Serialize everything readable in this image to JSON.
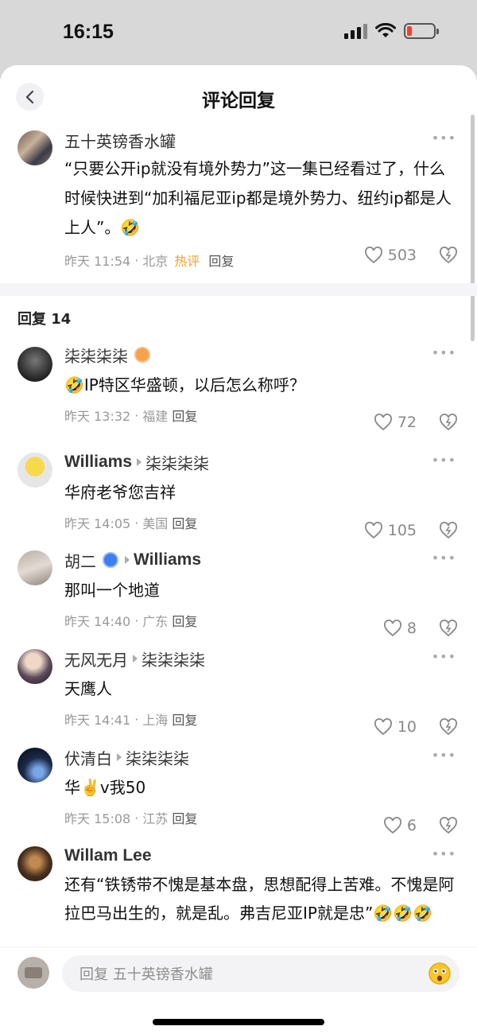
{
  "status": {
    "time": "16:15"
  },
  "header": {
    "title": "评论回复"
  },
  "main_comment": {
    "author": "五十英镑香水罐",
    "text": "“只要公开ip就没有境外势力”这一集已经看过了，什么时候快进到“加利福尼亚ip都是境外势力、纽约ip都是人上人”。🤣",
    "time": "昨天 11:54",
    "location": "北京",
    "hot_label": "热评",
    "reply_label": "回复",
    "likes": "503"
  },
  "replies_header": "回复 14",
  "replies": [
    {
      "author": "柒柒柒柒",
      "target": "",
      "text": "🤣IP特区华盛顿，以后怎么称呼？",
      "time": "昨天 13:32",
      "location": "福建",
      "reply_label": "回复",
      "likes": "72"
    },
    {
      "author": "Williams",
      "target": "柒柒柒柒",
      "text": "华府老爷您吉祥",
      "time": "昨天 14:05",
      "location": "美国",
      "reply_label": "回复",
      "likes": "105"
    },
    {
      "author": "胡二",
      "target": "Williams",
      "text": "那叫一个地道",
      "time": "昨天 14:40",
      "location": "广东",
      "reply_label": "回复",
      "likes": "8"
    },
    {
      "author": "无风无月",
      "target": "柒柒柒柒",
      "text": "天鹰人",
      "time": "昨天 14:41",
      "location": "上海",
      "reply_label": "回复",
      "likes": "10"
    },
    {
      "author": "伏清白",
      "target": "柒柒柒柒",
      "text": "华✌️v我50",
      "time": "昨天 15:08",
      "location": "江苏",
      "reply_label": "回复",
      "likes": "6"
    },
    {
      "author": "Willam Lee",
      "target": "",
      "text": "还有“铁锈带不愧是基本盘，思想配得上苦难。不愧是阿拉巴马出生的，就是乱。弗吉尼亚IP就是忠”🤣🤣🤣",
      "time": "",
      "location": "",
      "reply_label": "",
      "likes": ""
    }
  ],
  "bottom": {
    "placeholder": "回复 五十英镑香水罐"
  },
  "colors": {
    "hot": "#f2a12a",
    "accent_blue": "#3d7ef0",
    "battery_low": "#ff3b30"
  }
}
